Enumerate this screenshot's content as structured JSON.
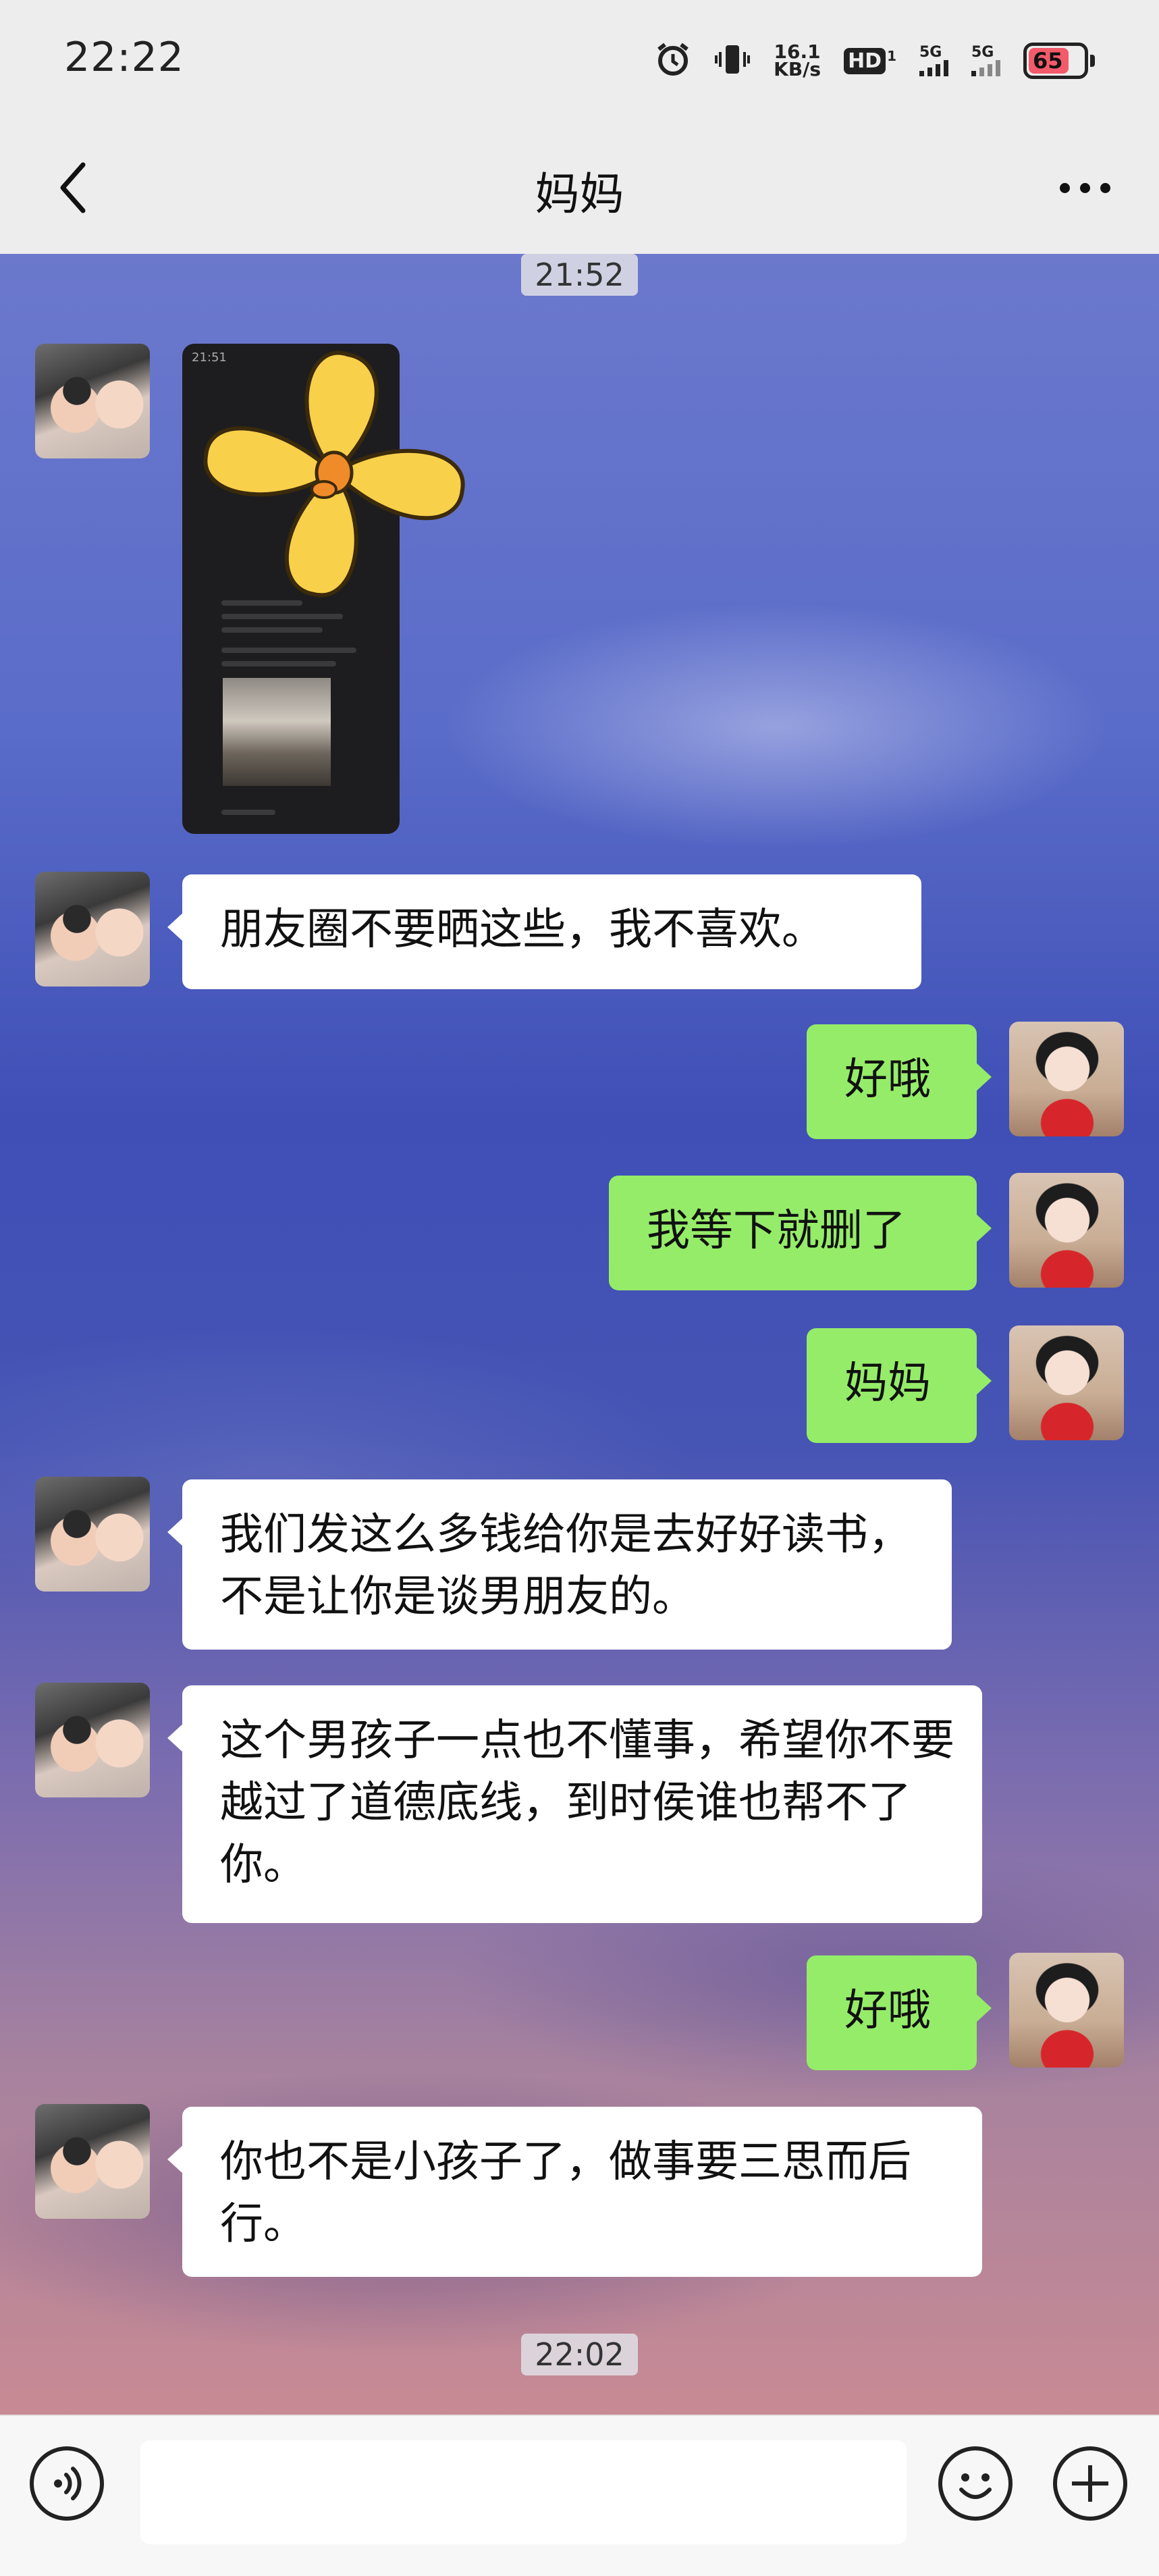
{
  "status_bar": {
    "time": "22:22",
    "net_speed_value": "16.1",
    "net_speed_unit": "KB/s",
    "hd_label": "HD",
    "hd_sub": "1",
    "sim1_label": "5G",
    "sim2_label": "5G",
    "battery_level": "65",
    "battery_color": "#f35a6a",
    "icons": [
      "alarm-icon",
      "vibrate-icon",
      "hd-icon",
      "signal-icon",
      "signal-icon",
      "battery-icon"
    ]
  },
  "nav": {
    "title": "妈妈",
    "back_icon": "chevron-left-icon",
    "more_icon": "more-dots-icon"
  },
  "chat": {
    "timestamps": [
      "21:52",
      "22:02"
    ],
    "image_message": {
      "sender": "mom",
      "caption_top": "21:51"
    },
    "messages": [
      {
        "sender": "mom",
        "text": "朋友圈不要晒这些，我不喜欢。"
      },
      {
        "sender": "me",
        "text": "好哦"
      },
      {
        "sender": "me",
        "text": "我等下就删了"
      },
      {
        "sender": "me",
        "text": "妈妈"
      },
      {
        "sender": "mom",
        "text": "我们发这么多钱给你是去好好读书，不是让你是谈男朋友的。"
      },
      {
        "sender": "mom",
        "text": "这个男孩子一点也不懂事，希望你不要越过了道德底线，到时侯谁也帮不了你。"
      },
      {
        "sender": "me",
        "text": "好哦"
      },
      {
        "sender": "mom",
        "text": "你也不是小孩子了，做事要三思而后行。"
      }
    ]
  },
  "input_bar": {
    "voice_icon": "voice-icon",
    "emoji_icon": "emoji-icon",
    "plus_icon": "plus-icon",
    "input_value": ""
  },
  "colors": {
    "sent_bubble": "#95ec69",
    "received_bubble": "#ffffff",
    "chrome_bg": "#ededed"
  }
}
